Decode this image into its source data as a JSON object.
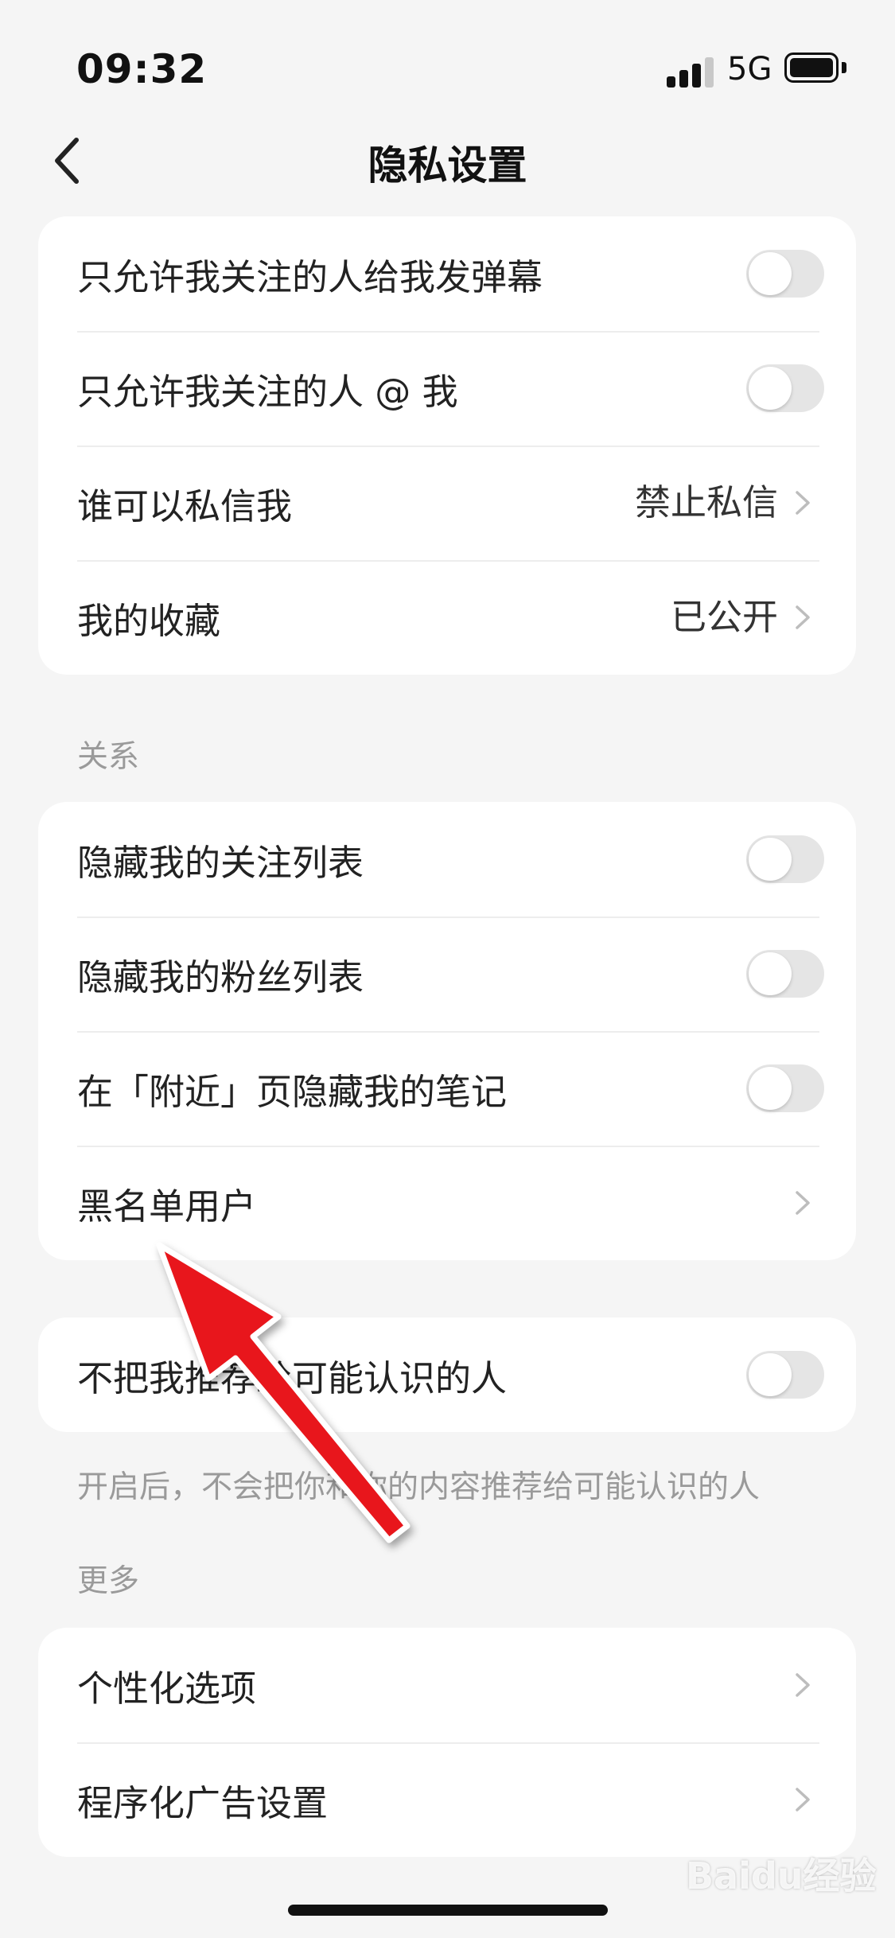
{
  "status_bar": {
    "time": "09:32",
    "network": "5G"
  },
  "nav": {
    "title": "隐私设置",
    "back_icon": "chevron-left-icon"
  },
  "interaction_card": {
    "rows": [
      {
        "label": "只允许我关注的人给我发弹幕",
        "control": "toggle",
        "on": false
      },
      {
        "label": "只允许我关注的人 @ 我",
        "control": "toggle",
        "on": false
      },
      {
        "label": "谁可以私信我",
        "value": "禁止私信",
        "control": "chevron"
      },
      {
        "label": "我的收藏",
        "value": "已公开",
        "control": "chevron"
      }
    ]
  },
  "relations": {
    "section_label": "关系",
    "rows": [
      {
        "label": "隐藏我的关注列表",
        "control": "toggle",
        "on": false
      },
      {
        "label": "隐藏我的粉丝列表",
        "control": "toggle",
        "on": false
      },
      {
        "label": "在「附近」页隐藏我的笔记",
        "control": "toggle",
        "on": false
      },
      {
        "label": "黑名单用户",
        "control": "chevron"
      }
    ]
  },
  "recommend": {
    "label": "不把我推荐给可能认识的人",
    "on": false,
    "note": "开启后，不会把你和你的内容推荐给可能认识的人"
  },
  "more": {
    "section_label": "更多",
    "rows": [
      {
        "label": "个性化选项",
        "control": "chevron"
      },
      {
        "label": "程序化广告设置",
        "control": "chevron"
      }
    ]
  },
  "watermark": "Baidu经验",
  "colors": {
    "background": "#f5f5f5",
    "card": "#ffffff",
    "toggle_off": "#e5e5e5",
    "annotation_arrow": "#e8191e"
  }
}
